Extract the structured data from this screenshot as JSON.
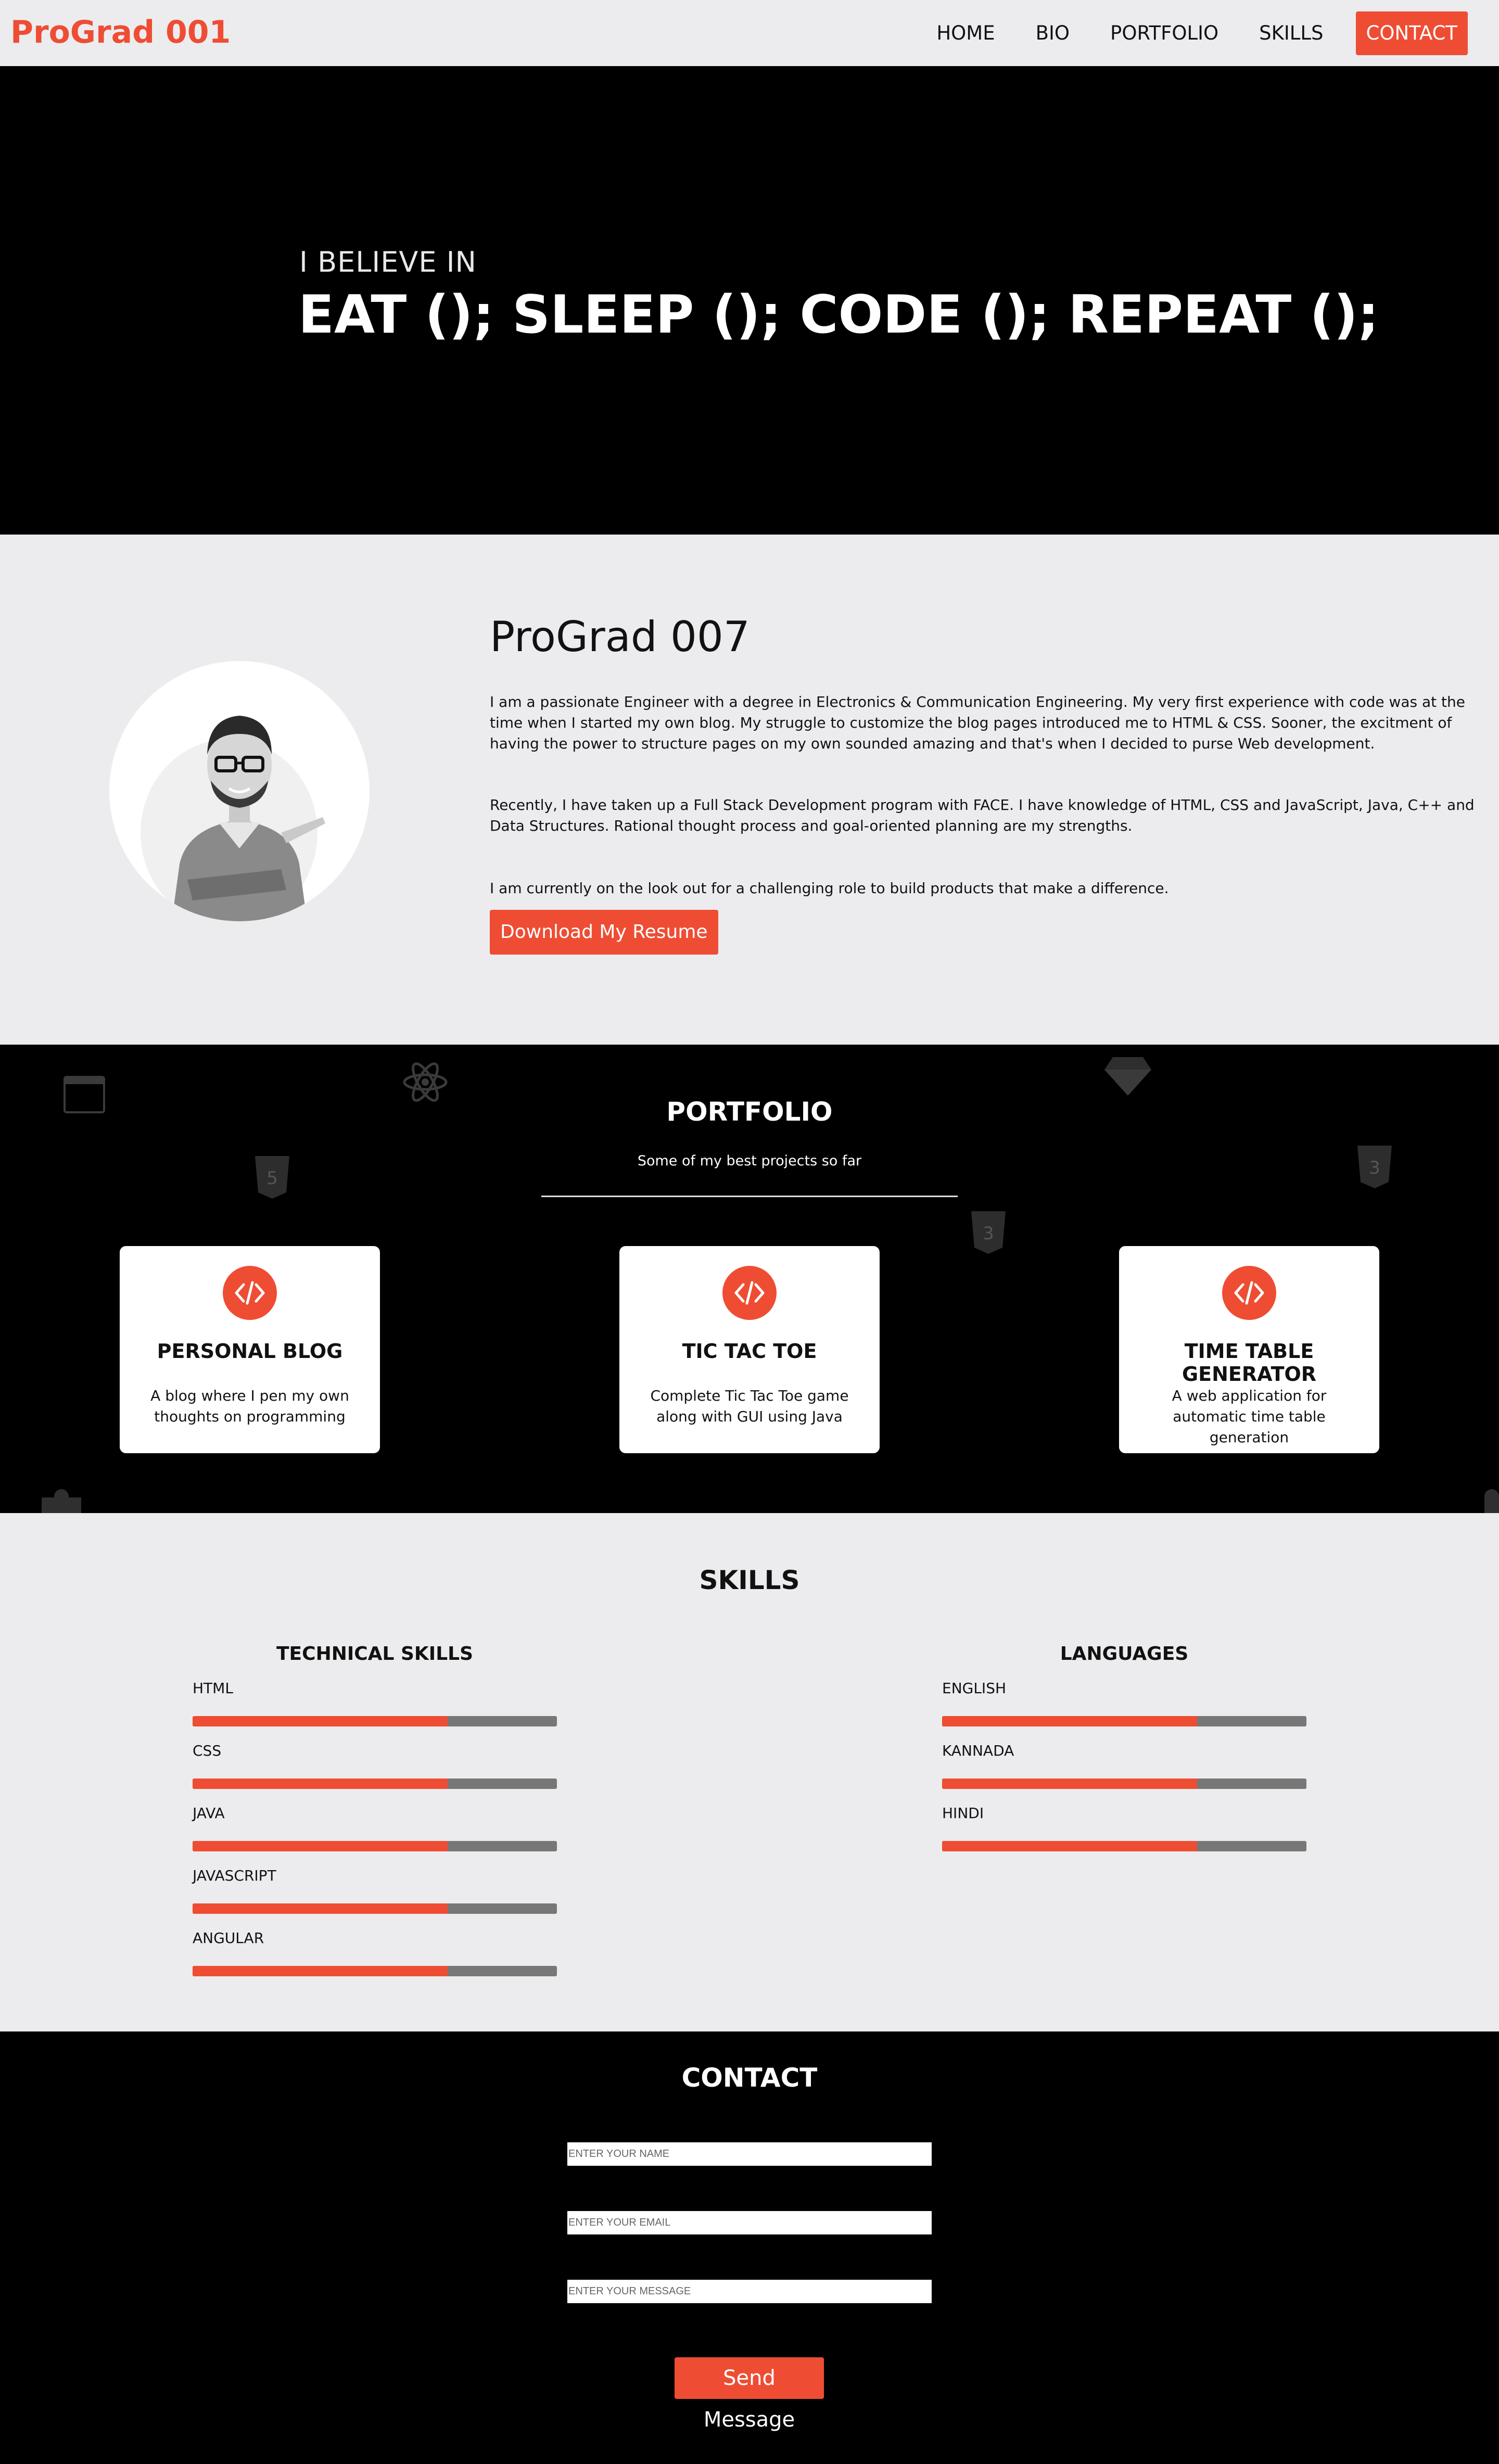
{
  "nav": {
    "logo": "ProGrad 001",
    "links": [
      "HOME",
      "BIO",
      "PORTFOLIO",
      "SKILLS"
    ],
    "contact_label": "CONTACT"
  },
  "hero": {
    "small": "I BELIEVE IN",
    "big": "EAT (); SLEEP (); CODE (); REPEAT ();"
  },
  "bio": {
    "name": "ProGrad 007",
    "paragraphs": [
      "I am a passionate Engineer with a degree in Electronics & Communication Engineering. My very first experience with code was at the time when I started my own blog. My struggle to customize the blog pages introduced me to HTML & CSS. Sooner, the excitment of having the power to structure pages on my own sounded amazing and that's when I decided to purse Web development.",
      "Recently, I have taken up a Full Stack Development program with FACE. I have knowledge of HTML, CSS and JavaScript, Java, C++ and Data Structures. Rational thought process and goal-oriented planning are my strengths.",
      "I am currently on the look out for a challenging role to build products that make a difference."
    ],
    "resume_button": "Download My Resume"
  },
  "portfolio": {
    "title": "PORTFOLIO",
    "subtitle": "Some of my best projects so far",
    "cards": [
      {
        "title": "PERSONAL BLOG",
        "desc": "A blog where I pen my own thoughts on programming",
        "icon": "code-icon"
      },
      {
        "title": "TIC TAC TOE",
        "desc": "Complete Tic Tac Toe game along with GUI using Java",
        "icon": "code-icon"
      },
      {
        "title": "TIME TABLE GENERATOR",
        "desc": "A web application for automatic time table generation",
        "icon": "code-icon"
      }
    ]
  },
  "skills": {
    "title": "SKILLS",
    "technical_title": "TECHNICAL SKILLS",
    "technical": [
      {
        "name": "HTML",
        "level": 0.7
      },
      {
        "name": "CSS",
        "level": 0.7
      },
      {
        "name": "JAVA",
        "level": 0.7
      },
      {
        "name": "JAVASCRIPT",
        "level": 0.7
      },
      {
        "name": "ANGULAR",
        "level": 0.7
      }
    ],
    "languages_title": "LANGUAGES",
    "languages": [
      {
        "name": "ENGLISH",
        "level": 0.7
      },
      {
        "name": "KANNADA",
        "level": 0.7
      },
      {
        "name": "HINDI",
        "level": 0.7
      }
    ]
  },
  "contact": {
    "title": "CONTACT",
    "name_placeholder": "ENTER YOUR NAME",
    "email_placeholder": "ENTER YOUR EMAIL",
    "message_placeholder": "ENTER YOUR MESSAGE",
    "send_button": "Send Message"
  },
  "colors": {
    "accent": "#ee4d34",
    "dark": "#000000",
    "light": "#ececee"
  }
}
